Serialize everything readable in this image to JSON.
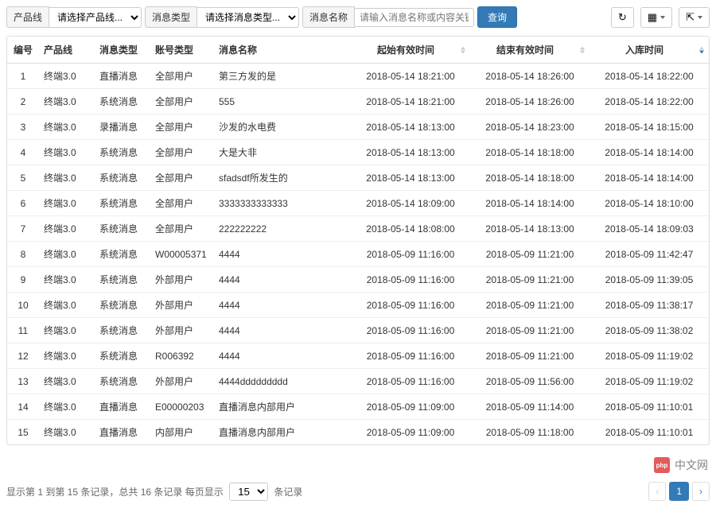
{
  "toolbar": {
    "product_label": "产品线",
    "product_placeholder": "请选择产品线...",
    "msgtype_label": "消息类型",
    "msgtype_placeholder": "请选择消息类型...",
    "msgname_label": "消息名称",
    "msgname_placeholder": "请输入消息名称或内容关键:",
    "query_label": "查询"
  },
  "columns": {
    "c0": "编号",
    "c1": "产品线",
    "c2": "消息类型",
    "c3": "账号类型",
    "c4": "消息名称",
    "c5": "起始有效时间",
    "c6": "结束有效时间",
    "c7": "入库时间"
  },
  "rows": [
    {
      "no": "1",
      "product": "终端3.0",
      "msgtype": "直播消息",
      "account": "全部用户",
      "name": "第三方发的是",
      "start": "2018-05-14 18:21:00",
      "end": "2018-05-14 18:26:00",
      "store": "2018-05-14 18:22:00"
    },
    {
      "no": "2",
      "product": "终端3.0",
      "msgtype": "系统消息",
      "account": "全部用户",
      "name": "555",
      "start": "2018-05-14 18:21:00",
      "end": "2018-05-14 18:26:00",
      "store": "2018-05-14 18:22:00"
    },
    {
      "no": "3",
      "product": "终端3.0",
      "msgtype": "录播消息",
      "account": "全部用户",
      "name": "沙发的水电费",
      "start": "2018-05-14 18:13:00",
      "end": "2018-05-14 18:23:00",
      "store": "2018-05-14 18:15:00"
    },
    {
      "no": "4",
      "product": "终端3.0",
      "msgtype": "系统消息",
      "account": "全部用户",
      "name": "大是大非",
      "start": "2018-05-14 18:13:00",
      "end": "2018-05-14 18:18:00",
      "store": "2018-05-14 18:14:00"
    },
    {
      "no": "5",
      "product": "终端3.0",
      "msgtype": "系统消息",
      "account": "全部用户",
      "name": "sfadsdf所发生的",
      "start": "2018-05-14 18:13:00",
      "end": "2018-05-14 18:18:00",
      "store": "2018-05-14 18:14:00"
    },
    {
      "no": "6",
      "product": "终端3.0",
      "msgtype": "系统消息",
      "account": "全部用户",
      "name": "3333333333333",
      "start": "2018-05-14 18:09:00",
      "end": "2018-05-14 18:14:00",
      "store": "2018-05-14 18:10:00"
    },
    {
      "no": "7",
      "product": "终端3.0",
      "msgtype": "系统消息",
      "account": "全部用户",
      "name": "222222222",
      "start": "2018-05-14 18:08:00",
      "end": "2018-05-14 18:13:00",
      "store": "2018-05-14 18:09:03"
    },
    {
      "no": "8",
      "product": "终端3.0",
      "msgtype": "系统消息",
      "account": "W00005371",
      "name": "4444",
      "start": "2018-05-09 11:16:00",
      "end": "2018-05-09 11:21:00",
      "store": "2018-05-09 11:42:47"
    },
    {
      "no": "9",
      "product": "终端3.0",
      "msgtype": "系统消息",
      "account": "外部用户",
      "name": "4444",
      "start": "2018-05-09 11:16:00",
      "end": "2018-05-09 11:21:00",
      "store": "2018-05-09 11:39:05"
    },
    {
      "no": "10",
      "product": "终端3.0",
      "msgtype": "系统消息",
      "account": "外部用户",
      "name": "4444",
      "start": "2018-05-09 11:16:00",
      "end": "2018-05-09 11:21:00",
      "store": "2018-05-09 11:38:17"
    },
    {
      "no": "11",
      "product": "终端3.0",
      "msgtype": "系统消息",
      "account": "外部用户",
      "name": "4444",
      "start": "2018-05-09 11:16:00",
      "end": "2018-05-09 11:21:00",
      "store": "2018-05-09 11:38:02"
    },
    {
      "no": "12",
      "product": "终端3.0",
      "msgtype": "系统消息",
      "account": "R006392",
      "name": "4444",
      "start": "2018-05-09 11:16:00",
      "end": "2018-05-09 11:21:00",
      "store": "2018-05-09 11:19:02"
    },
    {
      "no": "13",
      "product": "终端3.0",
      "msgtype": "系统消息",
      "account": "外部用户",
      "name": "4444ddddddddd",
      "start": "2018-05-09 11:16:00",
      "end": "2018-05-09 11:56:00",
      "store": "2018-05-09 11:19:02"
    },
    {
      "no": "14",
      "product": "终端3.0",
      "msgtype": "直播消息",
      "account": "E00000203",
      "name": "直播消息内部用户",
      "start": "2018-05-09 11:09:00",
      "end": "2018-05-09 11:14:00",
      "store": "2018-05-09 11:10:01"
    },
    {
      "no": "15",
      "product": "终端3.0",
      "msgtype": "直播消息",
      "account": "内部用户",
      "name": "直播消息内部用户",
      "start": "2018-05-09 11:09:00",
      "end": "2018-05-09 11:18:00",
      "store": "2018-05-09 11:10:01"
    }
  ],
  "footer": {
    "info_prefix": "显示第 1 到第 15 条记录，总共 16 条记录 每页显示",
    "page_size": "15",
    "info_suffix": "条记录",
    "prev": "‹",
    "page1": "1",
    "next": "›"
  },
  "watermark": {
    "logo_text": "php",
    "text": "中文网"
  }
}
